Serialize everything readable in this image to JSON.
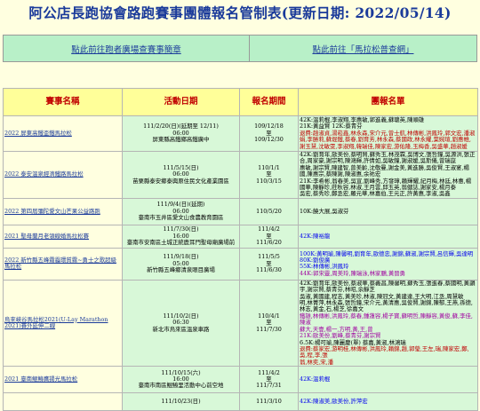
{
  "page_title": "阿公店長跑協會路跑賽事團體報名管制表(更新日期: 2022/05/14)",
  "nav": {
    "left_link": "點此前往跑者廣場查賽事簡章",
    "right_link": "點此前往「馬拉松普查網」"
  },
  "table": {
    "headers": {
      "race": "賽事名稱",
      "event": "活動日期",
      "period": "報名期間",
      "team": "團報名單"
    },
    "rows": [
      {
        "race": "2022 屏東高鐵盃鐵馬拉松",
        "event_date": "111/2/20(日)(延期至 12/11)",
        "event_time": "06:00",
        "event_place": "屏東縣高鐵鄉高鐵廣中",
        "period_start": "109/12/18",
        "period_sep": "至",
        "period_end": "109/12/30",
        "team_1": "42K:溫莉棍,李淑翔,李惠敏,郭進義,蘇聰英,陳順雄",
        "team_2": "21K:黃益賢 12K:蔡青芬",
        "team_3": "退費:趙淑貞,湯菘鑫,林永森,宋介元,曾士航,林傳彬,洪鳳玲,郭文宏,潘淑娟,李勝莉,蘇焜鐵,蔡春,劉育芳,林永森,蔡國政,林永耀,葉婉瑄,劉惠帷,謝玉慧,沈敏雯,李淑翔,韓瑞佳,陳家宏,游佑隆,玉梅香,吳盛華,趙淑媛"
      },
      {
        "race": "2022 泰安溫泉經濟鐵路馬拉松",
        "event_date": "111/5/15(日)",
        "event_time": "06:00",
        "event_place": "苗栗縣泰安鄉泰興原住民文化產業園區",
        "period_start": "110/1/1",
        "period_sep": "至",
        "period_end": "110/3/15",
        "team_1": "42K:劉育年,歐美份,蔡明賢,蘇秀玉,林茂霖,吳博文,張哲鐘,吳源洪,張正合,周家豪,謝宗明,陳鴻輝,許倩如,吳敏鐘,謝淑媛,吳斯儀,曾瑞崑",
        "team_2": "惠敏,謝宗賢,陳建智,曾美齡,沈敬曼,謝金美,黃進勝,吳俊賢,王淑宴,楊國,陳惠宗,蔡陳謝,陳淑惠,余祐宏",
        "team_3": "21K:李希彬,翁春美,吳宣,劉峰秀,方發璋,賴輝耀,紀月梅,林廷,林惠,楊國華,陳靜珍,莊秋容,林淑,王月雲,邱玉英,翁健誌,謝家安,楊月泰",
        "team_4": "吳宏,蔡秀珍,鄭丞宏,羅元華,林嘉伯,王元正,許黃惠,李淑,吳鑫"
      },
      {
        "race": "2022 第四屆彌陀愛文山芒果公益路跑",
        "event_date": "111/9/4(日)(延期)",
        "event_time": "06:00",
        "event_place": "臺南市玉井區愛文山食農教育園區",
        "period_start": "110/5/20",
        "period_sep": "",
        "period_end": "",
        "team_1": "10K:饒大展,吳淑芬"
      },
      {
        "race": "2021 聖母蘭月老領線婚馬拉松賽",
        "event_date": "111/7/30(日)",
        "event_time": "16:00",
        "event_place": "臺南市安南區土城正統鹿耳門聖母廟廣場前",
        "period_start": "111/4/2",
        "period_sep": "至",
        "period_end": "111/6/20",
        "team_1": "42K:陳裕龍"
      },
      {
        "race": "2022 新竹縣五峰霧霾環質霧~勇士之歌超級馬拉松",
        "event_date": "111/9/18(日)",
        "event_time": "05:00",
        "event_place": "新竹縣五峰鄉清泉眼目廣場",
        "period_start": "111/5/5",
        "period_sep": "至",
        "period_end": "111/6/30",
        "team_1": "100K:黃明瑜,陳馨明,劉育年,歐德忠,謝錦,蘇淑,謝宗賢,呂信輝,吳達明",
        "team_2": "80K:劉俊廣",
        "team_3": "55K:林傳彬,洪鳳玲",
        "team_4": "44K:郭宋靈,周美玲,陳瑞泳,林家鵬,黃晉勇"
      },
      {
        "race": "烏來峽谷馬拉松2021(U-Lay Marathon 2021)賽外延伸二線",
        "event_date": "111/10/2(日)",
        "event_time": "06:30",
        "event_place": "新北市烏來區溫泉車路",
        "period_start": "110/4/1",
        "period_sep": "至",
        "period_end": "111/7/30",
        "team_1": "42K:劉育年,歐美份,蔡淑華,蔡義昌,陳馨明,蘇秀玉,張進春,蔡國明,黃韻宇,謝宗賢,蔡青芬,林昭,余靜芝",
        "team_2": "吳淑,黃國建,程志,黃美珍,林淑,陳冠文,黃建達,王大明,江丞,周慧敏",
        "team_3": "明,林菁萍,林永森,張哲鐘,宋介元,黃清惠,吳俊賢,謝錦,陳郁,王燕,孫德,林志,黃金,石,楊芝,徐嘉文",
        "team_4": "鐵雄,林傳彬,洪鳳玲,蔡春,鍾蓮容,楊子寶,蘇明哲,陳靜容,黃俊,蘇,李佳,陳淑",
        "team_5": "蘇大,天壹,楊一,方明,黃,王,曾",
        "team_6": "21K:歐美份,劉峰,蔡青芬,謝宗賢",
        "team_7": "6.5K:楊可瑜,陳麗慶(單) 蔡嘉,黃淑,林鴻瑞",
        "team_8": "退費:蔡家宏,游明桂,林傳彬,洪鳳玲,賴錦,趙,郭瑩,王左,瑞,陳家宏,鄭,吳,程,李,張",
        "team_9": "翁,林奕,宋,潘"
      },
      {
        "race": "2021 臺南鯤鯓鷹揚光馬拉松",
        "event_date": "111/10/15(六)",
        "event_time": "16:00",
        "event_place": "臺南市南區鯤鯓里活動中心前空地",
        "period_start": "111/4/2",
        "period_sep": "至",
        "period_end": "111/7/31",
        "team_1": "42K:溫莉棍"
      },
      {
        "race": "",
        "event_date": "111/10/23(日)",
        "event_time": "",
        "event_place": "",
        "period_start": "111/3/10",
        "period_sep": "",
        "period_end": "",
        "team_1": "42K:陳淑美,歐美份,許萍宏"
      }
    ]
  },
  "colors": {
    "background": "#ffffe0",
    "title": "#1a3a9a",
    "header_bg": "#ffff99",
    "header_text": "#c00000",
    "cell_bg": "#d8f8d8",
    "nav_bg": "#b8f0c8",
    "highlight_red": "#c00000",
    "purple": "#a000a0"
  }
}
